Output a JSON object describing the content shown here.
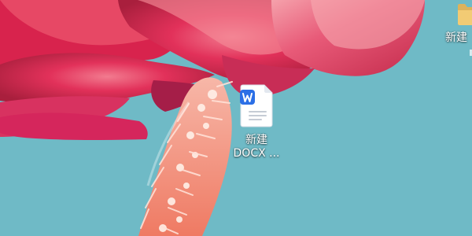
{
  "desktop": {
    "background_color": "#68b8c2",
    "icons": [
      {
        "icon": "wps-writer-doc-icon",
        "label_lines": [
          "新建",
          "DOCX ..."
        ]
      },
      {
        "icon": "folder-icon",
        "label_lines": [
          "新建"
        ]
      }
    ]
  },
  "colors": {
    "flower_pink": "#e2315a",
    "stamen": "#f39a85",
    "doc_blue": "#2b6fe6"
  }
}
